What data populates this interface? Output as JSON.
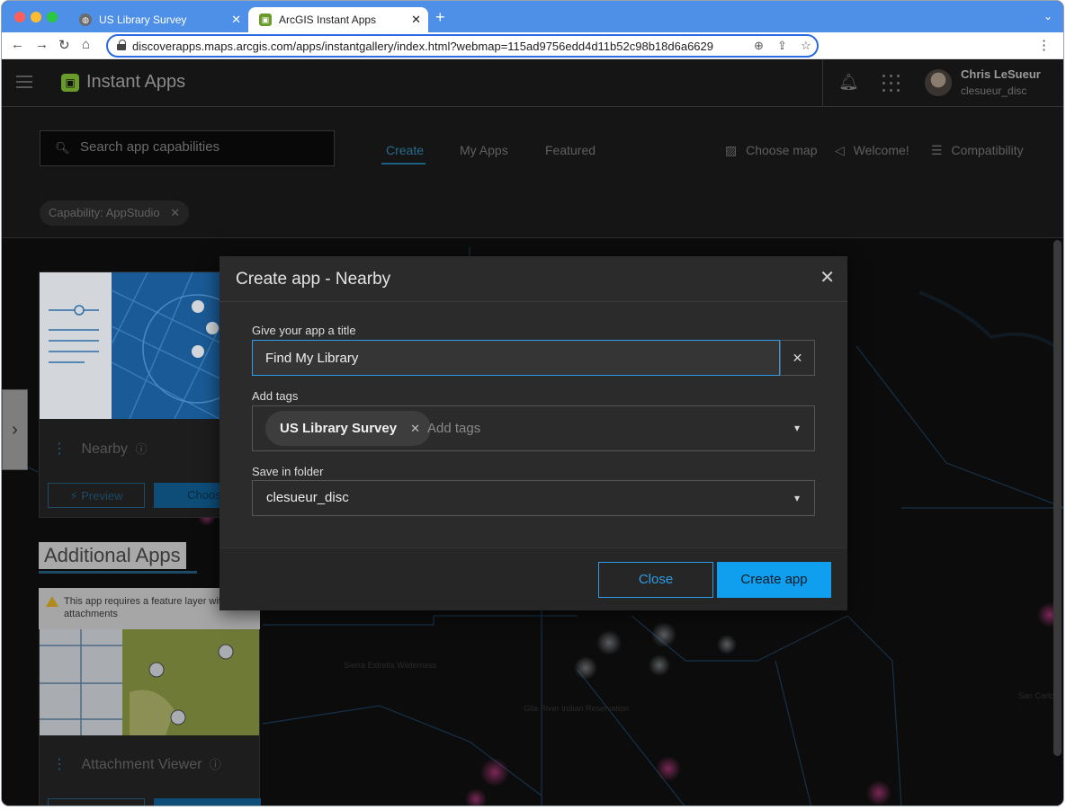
{
  "browser": {
    "tabs": [
      {
        "title": "US Library Survey",
        "active": false,
        "icon": "globe-favicon"
      },
      {
        "title": "ArcGIS Instant Apps",
        "active": true,
        "icon": "instant-apps-favicon"
      }
    ],
    "url": "discoverapps.maps.arcgis.com/apps/instantgallery/index.html?webmap=115ad9756edd4d11b52c98b18d6a6629"
  },
  "header": {
    "app_title": "Instant Apps",
    "user_name": "Chris LeSueur",
    "user_id": "clesueur_disc"
  },
  "subheader": {
    "search_placeholder": "Search app capabilities",
    "tabs": [
      {
        "label": "Create",
        "active": true
      },
      {
        "label": "My Apps",
        "active": false
      },
      {
        "label": "Featured",
        "active": false
      }
    ],
    "actions": [
      {
        "label": "Choose map",
        "icon": "map-icon"
      },
      {
        "label": "Welcome!",
        "icon": "megaphone-icon"
      },
      {
        "label": "Compatibility",
        "icon": "filter-icon"
      }
    ],
    "filter_chip": "Capability: AppStudio"
  },
  "gallery": {
    "card1": {
      "title": "Nearby",
      "preview_label": "Preview",
      "choose_label": "Choose"
    },
    "section_title": "Additional Apps",
    "warning": "This app requires a feature layer with attachments",
    "card2": {
      "title": "Attachment Viewer"
    }
  },
  "map_labels": [
    "Sierra Estrella Wilderness",
    "Gila River Indian Reservation",
    "San Carlos"
  ],
  "modal": {
    "title": "Create app - Nearby",
    "title_label": "Give your app a title",
    "title_value": "Find My Library",
    "tags_label": "Add tags",
    "tags": [
      "US Library Survey"
    ],
    "tags_placeholder": "Add tags",
    "folder_label": "Save in folder",
    "folder_value": "clesueur_disc",
    "close_label": "Close",
    "create_label": "Create app"
  },
  "colors": {
    "accent": "#2d9be5",
    "primary_button": "#0f9fee",
    "tab_strip": "#4e8fe8"
  }
}
